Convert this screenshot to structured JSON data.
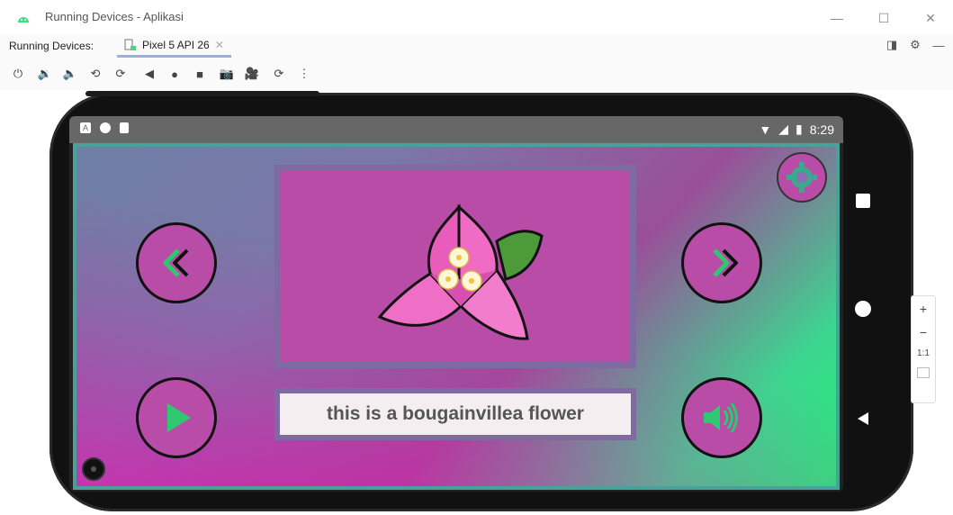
{
  "window": {
    "title": "Running Devices - Aplikasi"
  },
  "tabbar": {
    "label": "Running Devices:",
    "tab_name": "Pixel 5 API 26"
  },
  "status": {
    "time": "8:29"
  },
  "app": {
    "caption": "this is a bougainvillea flower"
  },
  "zoom": {
    "plus": "+",
    "minus": "−",
    "ratio": "1:1"
  },
  "colors": {
    "accent_green": "#2fc76f",
    "frame": "#7f6aa1",
    "magenta": "#b94ca6"
  },
  "icons": [
    "android-icon",
    "minimize-icon",
    "maximize-icon",
    "close-icon",
    "power-icon",
    "volume-up-icon",
    "volume-down-icon",
    "rotate-left-icon",
    "rotate-right-icon",
    "back-icon",
    "home-icon",
    "overview-icon",
    "camera-icon",
    "record-icon",
    "reset-icon",
    "more-icon",
    "settings-icon",
    "previous-icon",
    "next-icon",
    "play-icon",
    "speaker-icon"
  ]
}
